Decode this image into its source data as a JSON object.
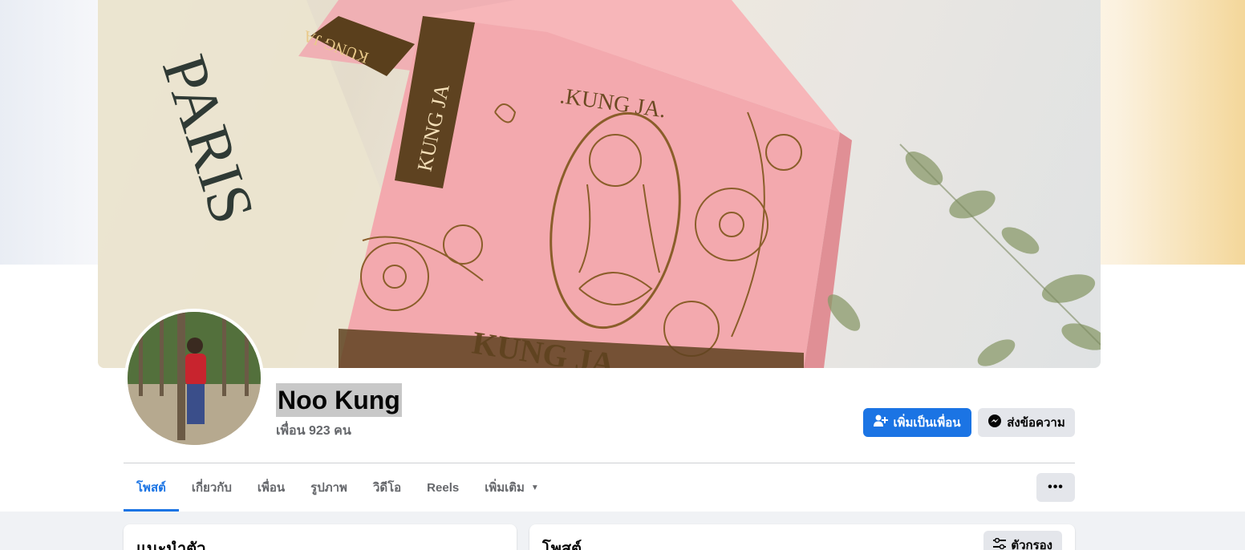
{
  "profile": {
    "name": "Noo Kung",
    "friends_text": "เพื่อน 923 คน"
  },
  "cover": {
    "text_paris": "PARIS",
    "text_brand_box": "KUNG JA",
    "text_brand_logo": ".KUNG JA.",
    "text_brand_bottom": "KUNG JA",
    "text_brand_back": "KUNG JA"
  },
  "actions": {
    "add_friend_label": "เพิ่มเป็นเพื่อน",
    "message_label": "ส่งข้อความ"
  },
  "tabs": [
    {
      "label": "โพสต์",
      "active": true
    },
    {
      "label": "เกี่ยวกับ",
      "active": false
    },
    {
      "label": "เพื่อน",
      "active": false
    },
    {
      "label": "รูปภาพ",
      "active": false
    },
    {
      "label": "วิดีโอ",
      "active": false
    },
    {
      "label": "Reels",
      "active": false
    },
    {
      "label": "เพิ่มเติม",
      "active": false
    }
  ],
  "more_menu_label": "•••",
  "intro_card": {
    "title": "แนะนำตัว"
  },
  "posts_card": {
    "title": "โพสต์",
    "filter_label": "ตัวกรอง"
  },
  "colors": {
    "accent": "#1b74e4",
    "secondary_button": "#e4e6eb",
    "page_background": "#f0f2f5",
    "box_pink": "#f3a9ae",
    "gold": "#7a5a2a"
  },
  "icons": {
    "add_friend": "add-friend-icon",
    "messenger": "messenger-icon",
    "caret": "caret-down-icon",
    "more": "more-icon",
    "filter": "filter-icon"
  }
}
